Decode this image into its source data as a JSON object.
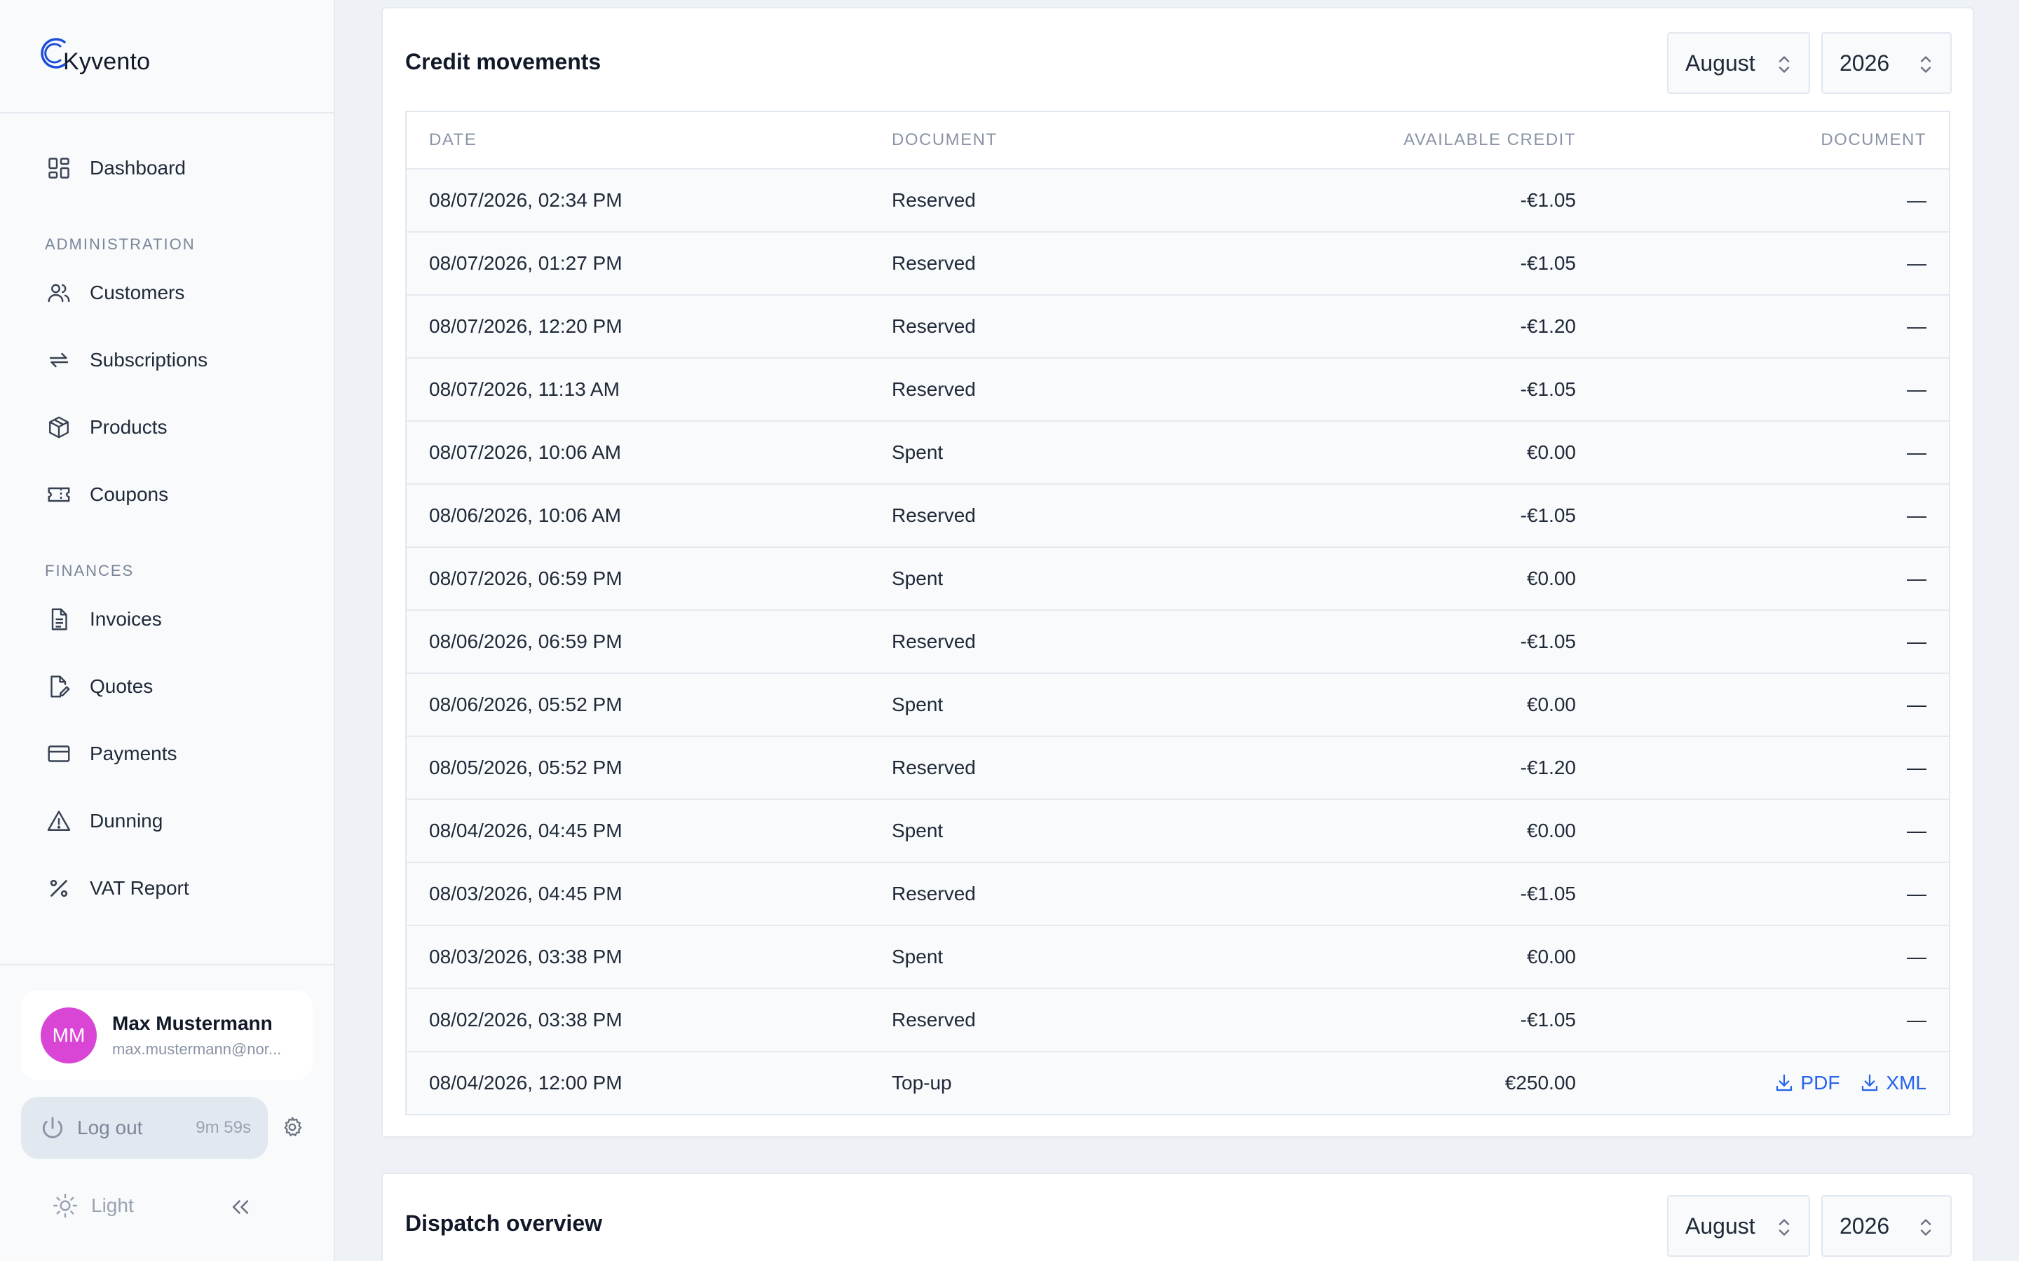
{
  "brand": {
    "name": "Kyvento"
  },
  "sidebar": {
    "items_top": [
      {
        "label": "Dashboard",
        "icon": "dashboard-icon"
      }
    ],
    "sections": [
      {
        "title": "ADMINISTRATION",
        "items": [
          {
            "label": "Customers",
            "icon": "users-icon"
          },
          {
            "label": "Subscriptions",
            "icon": "repeat-icon"
          },
          {
            "label": "Products",
            "icon": "box-icon"
          },
          {
            "label": "Coupons",
            "icon": "ticket-icon"
          }
        ]
      },
      {
        "title": "FINANCES",
        "items": [
          {
            "label": "Invoices",
            "icon": "document-icon"
          },
          {
            "label": "Quotes",
            "icon": "document-edit-icon"
          },
          {
            "label": "Payments",
            "icon": "credit-card-icon"
          },
          {
            "label": "Dunning",
            "icon": "warning-icon"
          },
          {
            "label": "VAT Report",
            "icon": "percent-icon"
          }
        ]
      }
    ],
    "user": {
      "initials": "MM",
      "name": "Max Mustermann",
      "email": "max.mustermann@nor..."
    },
    "logout": {
      "label": "Log out",
      "timer": "9m 59s"
    },
    "theme": {
      "label": "Light"
    }
  },
  "credit": {
    "title": "Credit movements",
    "month": "August",
    "year": "2026",
    "columns": [
      "DATE",
      "DOCUMENT",
      "AVAILABLE CREDIT",
      "DOCUMENT"
    ],
    "rows": [
      {
        "date": "08/07/2026, 02:34 PM",
        "doc": "Reserved",
        "credit": "-€1.05",
        "file": "—"
      },
      {
        "date": "08/07/2026, 01:27 PM",
        "doc": "Reserved",
        "credit": "-€1.05",
        "file": "—"
      },
      {
        "date": "08/07/2026, 12:20 PM",
        "doc": "Reserved",
        "credit": "-€1.20",
        "file": "—"
      },
      {
        "date": "08/07/2026, 11:13 AM",
        "doc": "Reserved",
        "credit": "-€1.05",
        "file": "—"
      },
      {
        "date": "08/07/2026, 10:06 AM",
        "doc": "Spent",
        "credit": "€0.00",
        "file": "—"
      },
      {
        "date": "08/06/2026, 10:06 AM",
        "doc": "Reserved",
        "credit": "-€1.05",
        "file": "—"
      },
      {
        "date": "08/07/2026, 06:59 PM",
        "doc": "Spent",
        "credit": "€0.00",
        "file": "—"
      },
      {
        "date": "08/06/2026, 06:59 PM",
        "doc": "Reserved",
        "credit": "-€1.05",
        "file": "—"
      },
      {
        "date": "08/06/2026, 05:52 PM",
        "doc": "Spent",
        "credit": "€0.00",
        "file": "—"
      },
      {
        "date": "08/05/2026, 05:52 PM",
        "doc": "Reserved",
        "credit": "-€1.20",
        "file": "—"
      },
      {
        "date": "08/04/2026, 04:45 PM",
        "doc": "Spent",
        "credit": "€0.00",
        "file": "—"
      },
      {
        "date": "08/03/2026, 04:45 PM",
        "doc": "Reserved",
        "credit": "-€1.05",
        "file": "—"
      },
      {
        "date": "08/03/2026, 03:38 PM",
        "doc": "Spent",
        "credit": "€0.00",
        "file": "—"
      },
      {
        "date": "08/02/2026, 03:38 PM",
        "doc": "Reserved",
        "credit": "-€1.05",
        "file": "—"
      }
    ],
    "last_row": {
      "date": "08/04/2026, 12:00 PM",
      "doc": "Top-up",
      "credit": "€250.00",
      "pdf": "PDF",
      "xml": "XML"
    }
  },
  "dispatch": {
    "title": "Dispatch overview",
    "month": "August",
    "year": "2026"
  },
  "colors": {
    "accent": "#2563eb",
    "avatar": "#d946d6"
  }
}
